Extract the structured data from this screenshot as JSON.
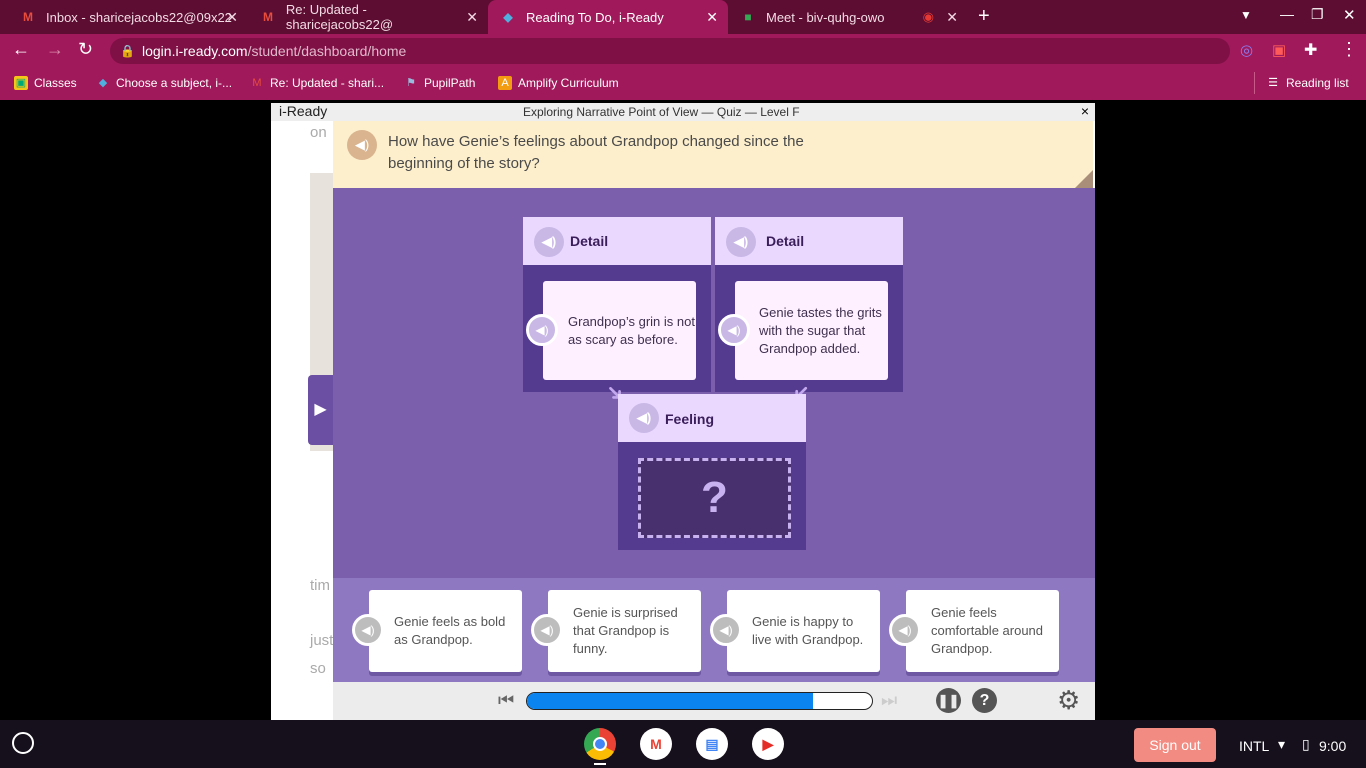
{
  "browser": {
    "tabs": [
      {
        "title": "Inbox - sharicejacobs22@09x22",
        "icon": "gmail-icon",
        "active": false
      },
      {
        "title": "Re: Updated - sharicejacobs22@",
        "icon": "gmail-icon",
        "active": false
      },
      {
        "title": "Reading To Do, i-Ready",
        "icon": "iready-icon",
        "active": true
      },
      {
        "title": "Meet - biv-quhg-owo",
        "icon": "meet-icon",
        "active": false
      }
    ],
    "url_host": "login.i-ready.com",
    "url_path": "/student/dashboard/home",
    "bookmarks": [
      "Classes",
      "Choose a subject, i-...",
      "Re: Updated - shari...",
      "PupilPath",
      "Amplify Curriculum"
    ],
    "reading_list": "Reading list"
  },
  "app": {
    "logo": "i-Ready",
    "title": "Exploring Narrative Point of View — Quiz — Level F",
    "close": "×",
    "left_fragments": [
      "on",
      "tim",
      "just",
      "so"
    ],
    "question": "How have Genie’s feelings about Grandpop changed since the beginning of the story?",
    "details": [
      {
        "label": "Detail",
        "text": "Grandpop’s grin is not as scary as before."
      },
      {
        "label": "Detail",
        "text": "Genie tastes the grits with the sugar that Grandpop added."
      }
    ],
    "feeling": {
      "label": "Feeling",
      "placeholder": "?"
    },
    "answers": [
      "Genie feels as bold as Grandpop.",
      "Genie is surprised that Grandpop is funny.",
      "Genie is happy to live with Grandpop.",
      "Genie feels comfortable around Grandpop."
    ],
    "progress_percent": 83,
    "help": "?"
  },
  "shelf": {
    "sign_out": "Sign out",
    "ime": "INTL",
    "time": "9:00"
  },
  "colors": {
    "accent": "#a0195a",
    "purple": "#7b5fad",
    "progress": "#0b84f0"
  }
}
